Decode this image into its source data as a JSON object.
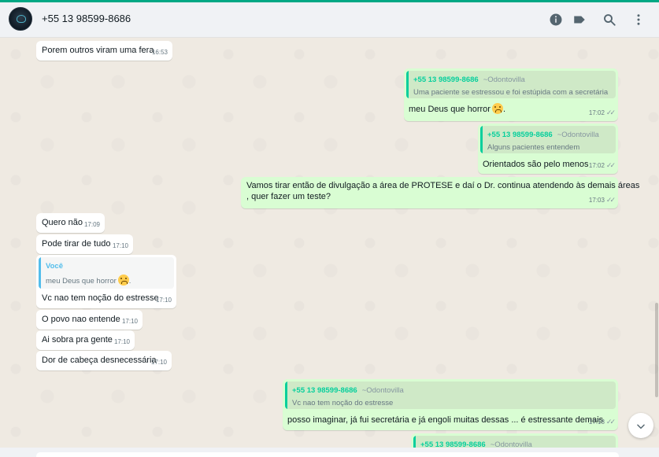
{
  "header": {
    "contact_name": "+55 13 98599-8686",
    "icons": [
      "info-icon",
      "label-icon",
      "search-icon",
      "menu-icon"
    ]
  },
  "messages": [
    {
      "dir": "in",
      "text": "Porem outros viram uma fera",
      "time": "16:53"
    },
    {
      "dir": "out",
      "quote": {
        "author": "+55 13 98599-8686",
        "tag": "~Odontovilla",
        "text": "Uma paciente se estressou e foi estúpida com a secretária"
      },
      "text": "meu Deus que horror",
      "emoji": "tired-face",
      "suffix": ".",
      "time": "17:02"
    },
    {
      "dir": "out",
      "quote": {
        "author": "+55 13 98599-8686",
        "tag": "~Odontovilla",
        "text": "Alguns pacientes entendem"
      },
      "text": "Orientados são pelo menos",
      "time": "17:02"
    },
    {
      "dir": "out",
      "text_line1": "Vamos tirar então de divulgação a área de PROTESE e daí o Dr. continua atendendo às demais áreas",
      "text_line2": ", quer fazer um teste?",
      "time": "17:03"
    },
    {
      "dir": "in",
      "text": "Quero não",
      "time": "17:09"
    },
    {
      "dir": "in",
      "text": "Pode tirar de tudo",
      "time": "17:10"
    },
    {
      "dir": "in",
      "quote": {
        "author": "Você",
        "text": "meu Deus que horror",
        "suffix": "."
      },
      "text": "Vc nao tem noção do estresse",
      "time": "17:10"
    },
    {
      "dir": "in",
      "text": "O povo nao entende",
      "time": "17:10"
    },
    {
      "dir": "in",
      "text": "Ai sobra pra gente",
      "time": "17:10"
    },
    {
      "dir": "in",
      "text": "Dor de cabeça desnecessária",
      "time": "17:10"
    },
    {
      "dir": "out",
      "quote": {
        "author": "+55 13 98599-8686",
        "tag": "~Odontovilla",
        "text": "Vc nao tem noção do estresse"
      },
      "text": "posso imaginar, já fui secretária e já engoli muitas dessas ... é estressante demais",
      "time": "17:18"
    },
    {
      "dir": "out",
      "quote": {
        "author": "+55 13 98599-8686",
        "tag": "~Odontovilla"
      }
    }
  ],
  "colors": {
    "accent": "#00a884",
    "outgoing_bubble": "#d9fdd3",
    "incoming_bubble": "#ffffff",
    "chat_background": "#efeae2",
    "quote_author_out": "#06cf9c",
    "quote_author_in": "#53bdeb"
  }
}
